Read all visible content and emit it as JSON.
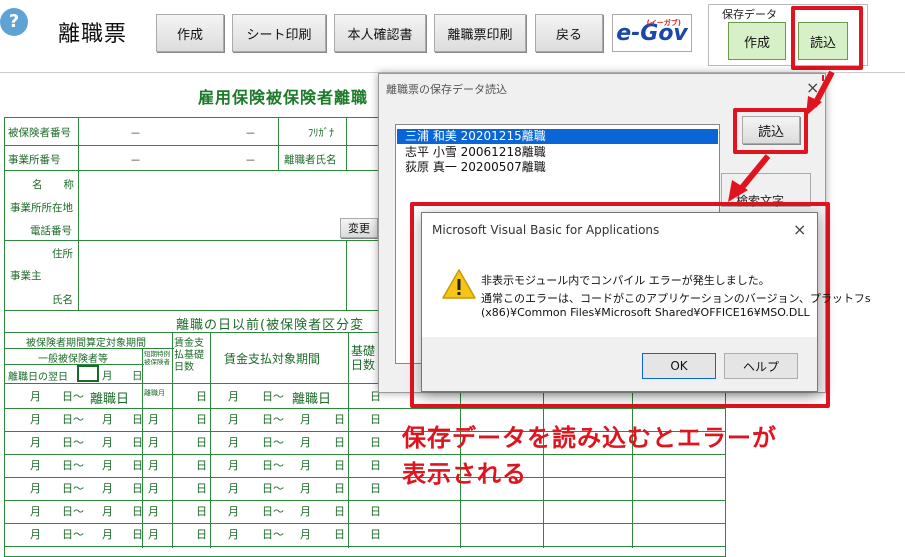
{
  "toolbar": {
    "title": "離職票",
    "help": "?",
    "buttons": [
      "作成",
      "シート印刷",
      "本人確認書",
      "離職票印刷",
      "戻る"
    ],
    "egov": "e-Gov",
    "egov_sub": "(イーガブ)",
    "save_group": {
      "label": "保存データ",
      "create": "作成",
      "load": "読込"
    }
  },
  "form": {
    "title": "雇用保険被保険者離職",
    "insured_no_label": "被保険者番号",
    "office_no_label": "事業所番号",
    "dash": "－",
    "furigana_label": "ﾌﾘｶﾞﾅ",
    "leaver_name_label": "離職者氏名",
    "name_label": "名　　称",
    "office_addr_label": "事業所所在地",
    "phone_label": "電話番号",
    "change_btn": "変更",
    "address_label": "住所",
    "employer_label": "事業主",
    "person_name_label": "氏名",
    "period_heading": "離職の日以前(被保険者区分変",
    "col_insured_period": "被保険者期間算定対象期間",
    "col_general": "一般被保険者等",
    "col_short": "短期特例被保険者",
    "col_leave_date": "離職日の翌日",
    "col_month": "月",
    "col_day": "日",
    "col_wage_days": "賃金支払基礎日数",
    "col_wage_period": "賃金支払対象期間",
    "col_base_days": "基礎日数",
    "row_first": [
      "月",
      "日～",
      "離職日",
      "離職月",
      "日",
      "月",
      "日～",
      "離職日",
      "日"
    ],
    "row_generic": [
      "月",
      "日～",
      "月",
      "日",
      "月",
      "日",
      "月",
      "日～",
      "月",
      "日",
      "日"
    ]
  },
  "load_dialog": {
    "title": "離職票の保存データ読込",
    "items": [
      "三浦 和美 20201215離職",
      "志平 小雪 20061218離職",
      "荻原 真一 20200507離職"
    ],
    "load_btn": "読込",
    "search_label": "検索文字",
    "close": "×"
  },
  "vba_dialog": {
    "title": "Microsoft Visual Basic for Applications",
    "close": "×",
    "line1": "非表示モジュール内でコンパイル エラーが発生しました。",
    "line2": "通常このエラーは、コードがこのアプリケーションのバージョン、プラットフs",
    "line3": "(x86)¥Common Files¥Microsoft Shared¥OFFICE16¥MSO.DLL",
    "ok": "OK",
    "help": "ヘルプ"
  },
  "annotation": {
    "line1": "保存データを読み込むとエラーが",
    "line2": "表示される",
    "color": "#e0141e"
  }
}
